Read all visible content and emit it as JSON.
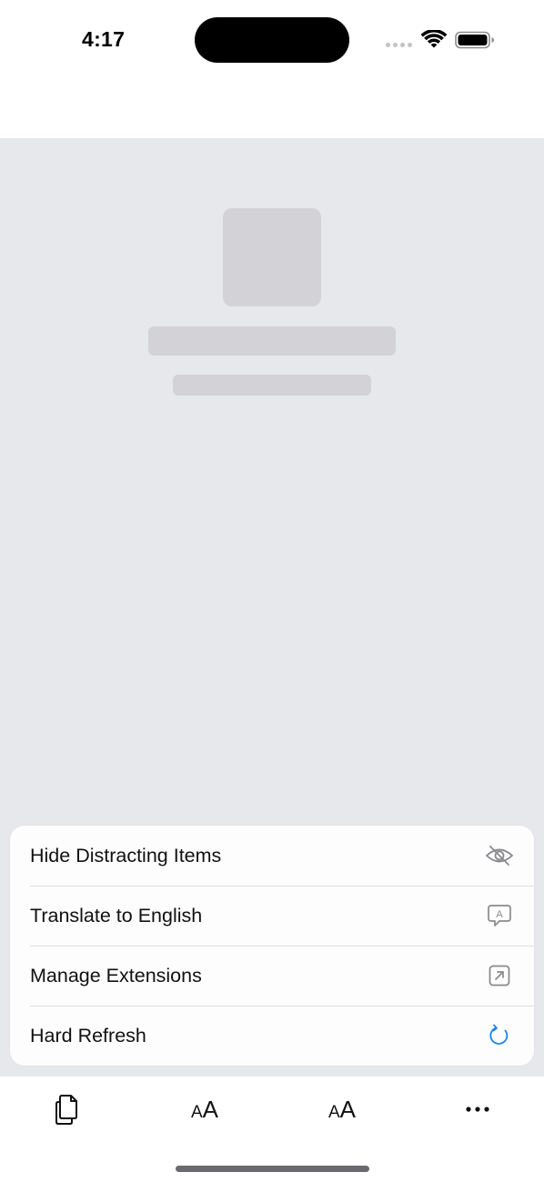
{
  "status_bar": {
    "time": "4:17"
  },
  "menu": {
    "items": [
      {
        "label": "Hide Distracting Items",
        "icon": "eye-slash-icon"
      },
      {
        "label": "Translate to English",
        "icon": "translate-bubble-icon"
      },
      {
        "label": "Manage Extensions",
        "icon": "external-arrow-box-icon"
      },
      {
        "label": "Hard Refresh",
        "icon": "refresh-icon"
      }
    ],
    "refresh_icon_color": "#1a84e8",
    "icon_color": "#8a8a8e"
  },
  "toolbar": {
    "buttons": [
      {
        "name": "tabs",
        "icon": "pages-icon"
      },
      {
        "name": "decrease-text-size",
        "label_small": "A",
        "label_large": "A"
      },
      {
        "name": "increase-text-size",
        "label_small": "A",
        "label_large": "A"
      },
      {
        "name": "more",
        "icon": "ellipsis-icon"
      }
    ]
  },
  "colors": {
    "content_background": "#e7e8ec",
    "placeholder": "#d2d2d7"
  }
}
